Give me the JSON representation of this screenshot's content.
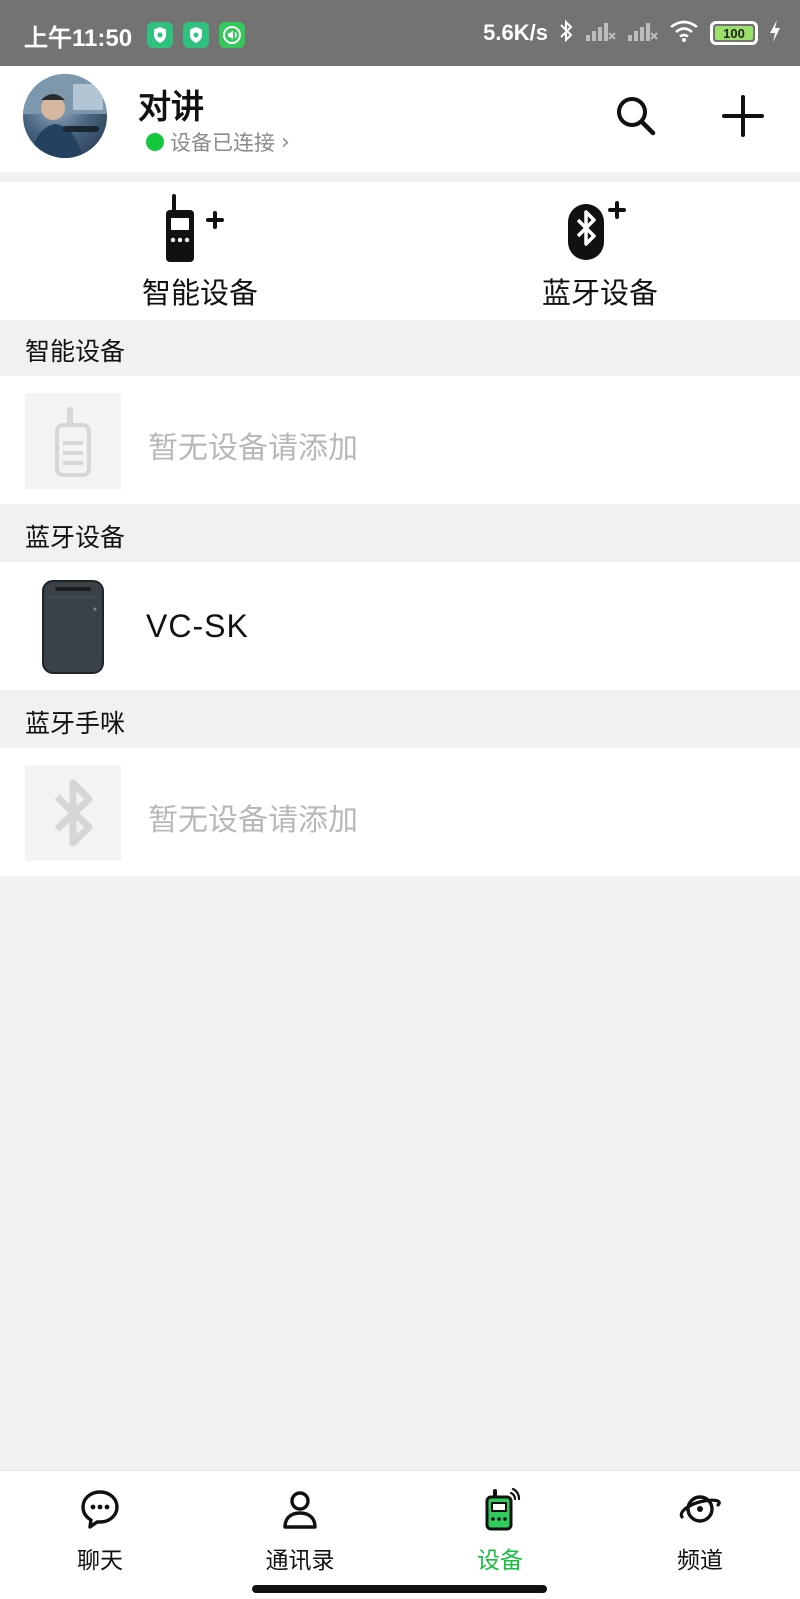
{
  "status_bar": {
    "time": "上午11:50",
    "speed": "5.6K/s",
    "battery": "100",
    "app_icons": [
      "shield-icon",
      "shield-icon",
      "speaker-icon"
    ]
  },
  "header": {
    "title": "对讲",
    "connection_status": "设备已连接",
    "chevron": "›",
    "status_color": "#14c73c"
  },
  "quick_add": [
    {
      "label": "智能设备",
      "icon": "walkie-talkie-add-icon"
    },
    {
      "label": "蓝牙设备",
      "icon": "bluetooth-add-icon"
    }
  ],
  "sections": [
    {
      "title": "智能设备",
      "items": [
        {
          "text": "暂无设备请添加",
          "empty": true,
          "icon": "walkie-talkie-placeholder-icon"
        }
      ]
    },
    {
      "title": "蓝牙设备",
      "items": [
        {
          "text": "VC-SK",
          "empty": false,
          "icon": "device-thumbnail"
        }
      ]
    },
    {
      "title": "蓝牙手咪",
      "items": [
        {
          "text": "暂无设备请添加",
          "empty": true,
          "icon": "bluetooth-placeholder-icon"
        }
      ]
    }
  ],
  "bottom_nav": [
    {
      "label": "聊天",
      "icon": "chat-icon",
      "active": false
    },
    {
      "label": "通讯录",
      "icon": "contacts-icon",
      "active": false
    },
    {
      "label": "设备",
      "icon": "device-icon",
      "active": true
    },
    {
      "label": "频道",
      "icon": "channel-planet-icon",
      "active": false
    }
  ],
  "colors": {
    "accent": "#17c03e",
    "status_bar": "#737373",
    "background": "#f1f1f1"
  }
}
